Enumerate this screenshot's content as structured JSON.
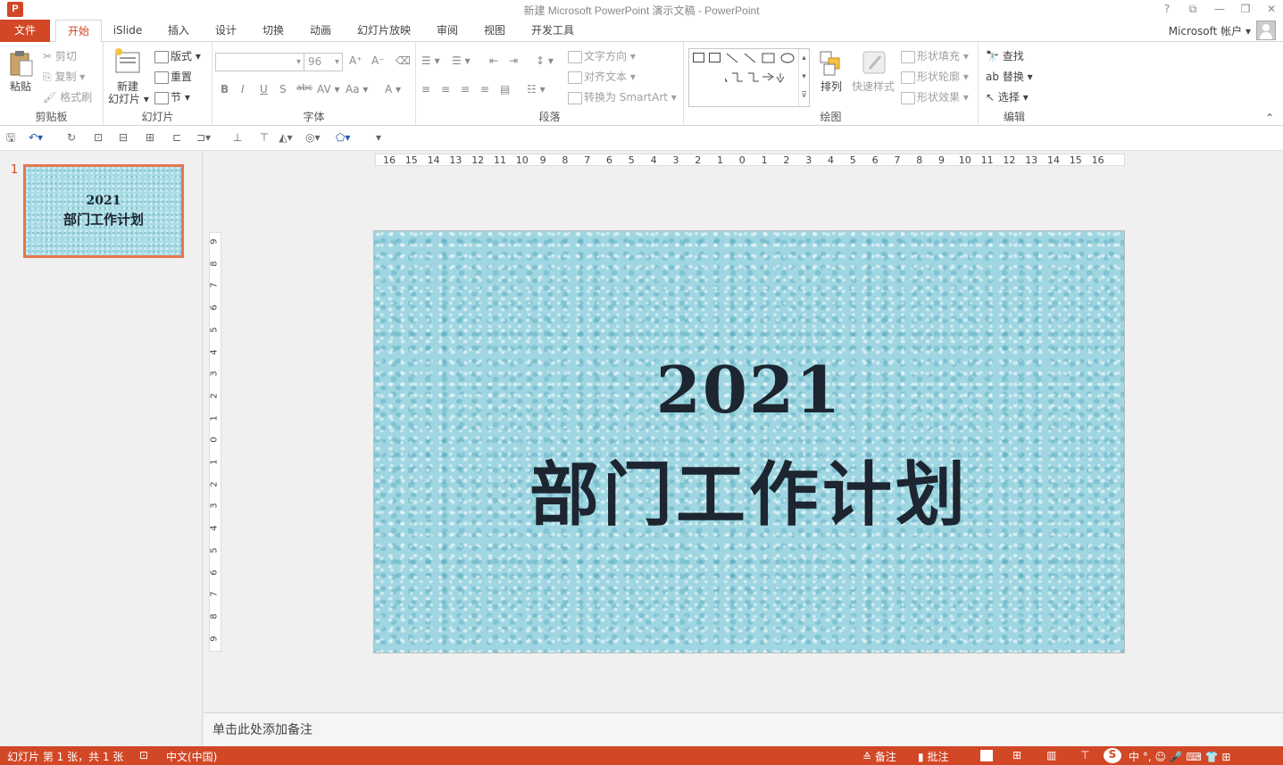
{
  "window": {
    "title": "新建 Microsoft PowerPoint 演示文稿 - PowerPoint",
    "app_icon": "P",
    "controls": [
      "?",
      "⧉",
      "—",
      "❐",
      "✕"
    ]
  },
  "tabs": [
    {
      "label": "文件",
      "kind": "file"
    },
    {
      "label": "开始",
      "kind": "active"
    },
    {
      "label": "iSlide",
      "kind": "normal"
    },
    {
      "label": "插入",
      "kind": "normal"
    },
    {
      "label": "设计",
      "kind": "normal"
    },
    {
      "label": "切换",
      "kind": "normal"
    },
    {
      "label": "动画",
      "kind": "normal"
    },
    {
      "label": "幻灯片放映",
      "kind": "normal"
    },
    {
      "label": "审阅",
      "kind": "normal"
    },
    {
      "label": "视图",
      "kind": "normal"
    },
    {
      "label": "开发工具",
      "kind": "normal"
    }
  ],
  "account": "Microsoft 帐户 ▾",
  "ribbon": {
    "clipboard": {
      "label": "剪贴板",
      "paste": "粘贴",
      "cut": "剪切",
      "copy": "复制",
      "format_painter": "格式刷"
    },
    "slides": {
      "label": "幻灯片",
      "new_slide_1": "新建",
      "new_slide_2": "幻灯片 ▾",
      "layout": "版式 ▾",
      "reset": "重置",
      "section": "节 ▾"
    },
    "font": {
      "label": "字体",
      "font_name": "",
      "font_size": "96",
      "bold": "B",
      "italic": "I",
      "underline": "U",
      "shadow": "S",
      "strike": "abc",
      "spacing": "AV ▾",
      "case": "Aa ▾",
      "color": "A ▾",
      "grow": "A⁺",
      "shrink": "A⁻"
    },
    "paragraph": {
      "label": "段落",
      "text_direction": "文字方向 ▾",
      "align_text": "对齐文本 ▾",
      "smartart": "转换为 SmartArt ▾"
    },
    "drawing": {
      "label": "绘图",
      "arrange": "排列",
      "quick_styles": "快速样式",
      "fill": "形状填充 ▾",
      "outline": "形状轮廓 ▾",
      "effects": "形状效果 ▾"
    },
    "editing": {
      "label": "编辑",
      "find": "查找",
      "replace": "替换 ▾",
      "select": "选择 ▾"
    }
  },
  "ruler": {
    "horizontal": [
      "16",
      "15",
      "14",
      "13",
      "12",
      "11",
      "10",
      "9",
      "8",
      "7",
      "6",
      "5",
      "4",
      "3",
      "2",
      "1",
      "0",
      "1",
      "2",
      "3",
      "4",
      "5",
      "6",
      "7",
      "8",
      "9",
      "10",
      "11",
      "12",
      "13",
      "14",
      "15",
      "16"
    ],
    "vertical": [
      "9",
      "8",
      "7",
      "6",
      "5",
      "4",
      "3",
      "2",
      "1",
      "0",
      "1",
      "2",
      "3",
      "4",
      "5",
      "6",
      "7",
      "8",
      "9"
    ]
  },
  "slide_panel": {
    "number": "1",
    "thumb_year": "2021",
    "thumb_title": "部门工作计划"
  },
  "slide": {
    "year": "2021",
    "title": "部门工作计划"
  },
  "notes": {
    "placeholder": "单击此处添加备注"
  },
  "status": {
    "slide_info": "幻灯片 第 1 张，共 1 张",
    "language": "中文(中国)",
    "notes_btn": "备注",
    "comments_btn": "批注",
    "ime": "中 °, ☺ 🎤 ⌨ 👕 ⊞"
  },
  "colors": {
    "accent": "#d24726",
    "slide_text": "#1c2530",
    "slide_bg": "#9fd6e1"
  }
}
